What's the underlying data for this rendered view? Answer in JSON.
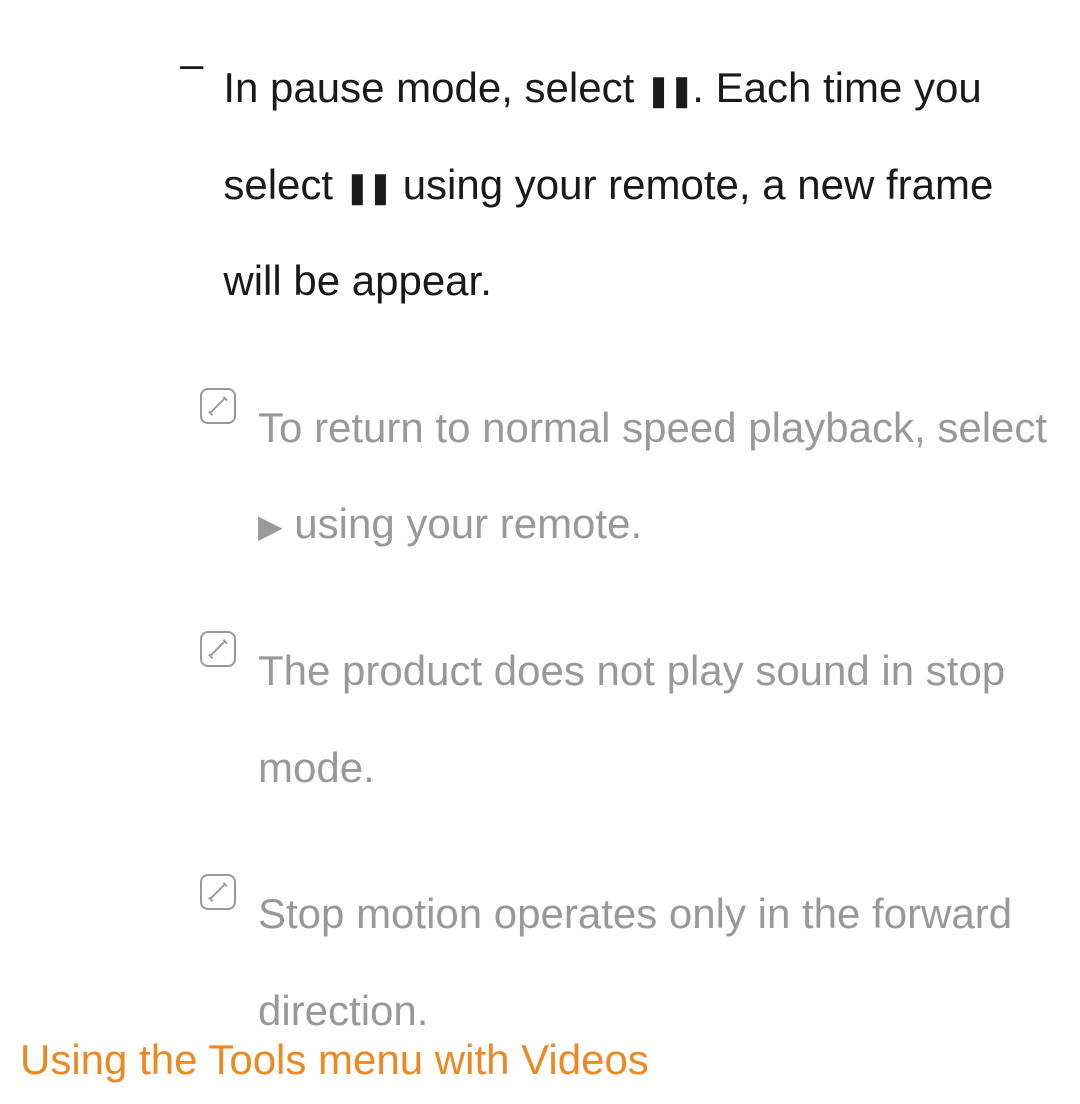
{
  "bullet": {
    "dash": "–",
    "text_before_pause1": "In pause mode, select ",
    "pause_icon": "❚❚",
    "text_after_pause1": ". Each time you select ",
    "text_after_pause2": " using your remote, a new frame will be appear."
  },
  "notes": [
    {
      "text_before": "To return to normal speed playback, select ",
      "play_icon": "▶",
      "text_after": " using your remote."
    },
    {
      "text_before": "The product does not play sound in stop mode.",
      "play_icon": "",
      "text_after": ""
    },
    {
      "text_before": "Stop motion operates only in the forward direction.",
      "play_icon": "",
      "text_after": ""
    }
  ],
  "heading": "Using the Tools menu with Videos"
}
